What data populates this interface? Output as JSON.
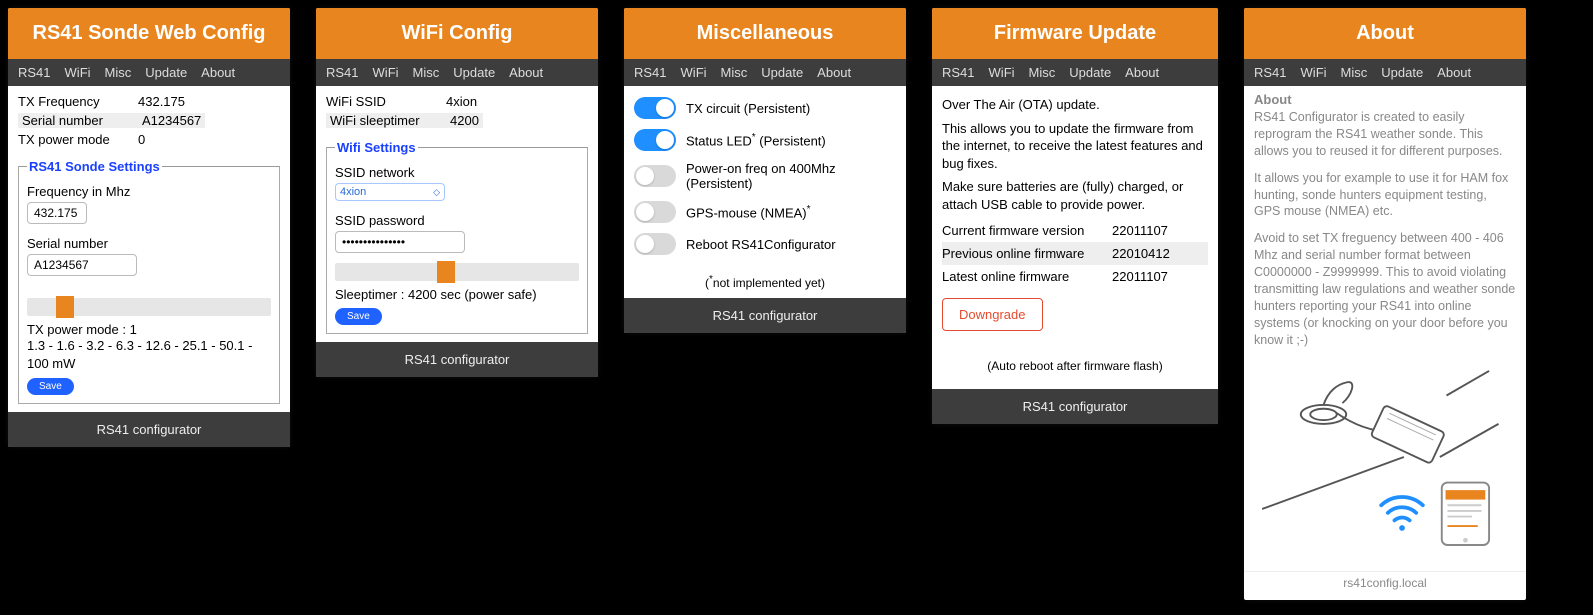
{
  "nav": [
    "RS41",
    "WiFi",
    "Misc",
    "Update",
    "About"
  ],
  "footer": "RS41 configurator",
  "p1": {
    "title": "RS41 Sonde Web Config",
    "rows": [
      {
        "label": "TX Frequency",
        "value": "432.175"
      },
      {
        "label": "Serial number",
        "value": "A1234567",
        "hl": true
      },
      {
        "label": "TX power mode",
        "value": "0"
      }
    ],
    "fs_title": "RS41 Sonde Settings",
    "freq_label": "Frequency in Mhz",
    "freq_val": "432.175",
    "serial_label": "Serial number",
    "serial_val": "A1234567",
    "pwr_line": "TX power mode : 1",
    "pwr_values": "1.3 - 1.6 - 3.2 - 6.3 - 12.6 - 25.1 - 50.1 - 100 mW",
    "save": "Save",
    "thumb_pct": 12
  },
  "p2": {
    "title": "WiFi Config",
    "rows": [
      {
        "label": "WiFi SSID",
        "value": "4xion"
      },
      {
        "label": "WiFi sleeptimer",
        "value": "4200",
        "hl": true
      }
    ],
    "fs_title": "Wifi Settings",
    "ssid_label": "SSID network",
    "ssid_val": "4xion",
    "pwd_label": "SSID password",
    "pwd_val": "•••••••••••••••",
    "sleep_line": "Sleeptimer : 4200 sec (power safe)",
    "save": "Save",
    "thumb_pct": 42
  },
  "p3": {
    "title": "Miscellaneous",
    "toggles": [
      {
        "on": true,
        "label": "TX circuit (Persistent)"
      },
      {
        "on": true,
        "label": "Status LED",
        "star": true,
        "suffix": " (Persistent)"
      },
      {
        "on": false,
        "label": "Power-on freq on 400Mhz (Persistent)"
      },
      {
        "on": false,
        "label": "GPS-mouse (NMEA)",
        "star": true,
        "suffix": ""
      },
      {
        "on": false,
        "label": "Reboot RS41Configurator"
      }
    ],
    "note": "(*not implemented yet)"
  },
  "p4": {
    "title": "Firmware Update",
    "para1": "Over The Air (OTA) update.",
    "para2": "This allows you to update the firmware from the internet, to receive the latest features and bug fixes.",
    "para3": "Make sure batteries are (fully) charged, or attach USB cable to provide power.",
    "rows": [
      {
        "label": "Current firmware version",
        "value": "22011107"
      },
      {
        "label": "Previous online firmware",
        "value": "22010412",
        "hl": true
      },
      {
        "label": "Latest online firmware",
        "value": "22011107"
      }
    ],
    "btn": "Downgrade",
    "auto": "(Auto reboot after firmware flash)"
  },
  "p5": {
    "title": "About",
    "h": "About",
    "p1": "RS41 Configurator is created to easily reprogram the RS41 weather sonde. This allows you to reused it for different purposes.",
    "p2": "It allows you for example to use it for HAM fox hunting, sonde hunters equipment testing, GPS mouse (NMEA) etc.",
    "p3": "Avoid to set TX freguency between 400 - 406 Mhz and serial number format between C0000000 - Z9999999. This to avoid violating transmitting law regulations and weather sonde hunters reporting your RS41 into online systems (or knocking on your door before you know it ;-)",
    "host": "rs41config.local"
  }
}
